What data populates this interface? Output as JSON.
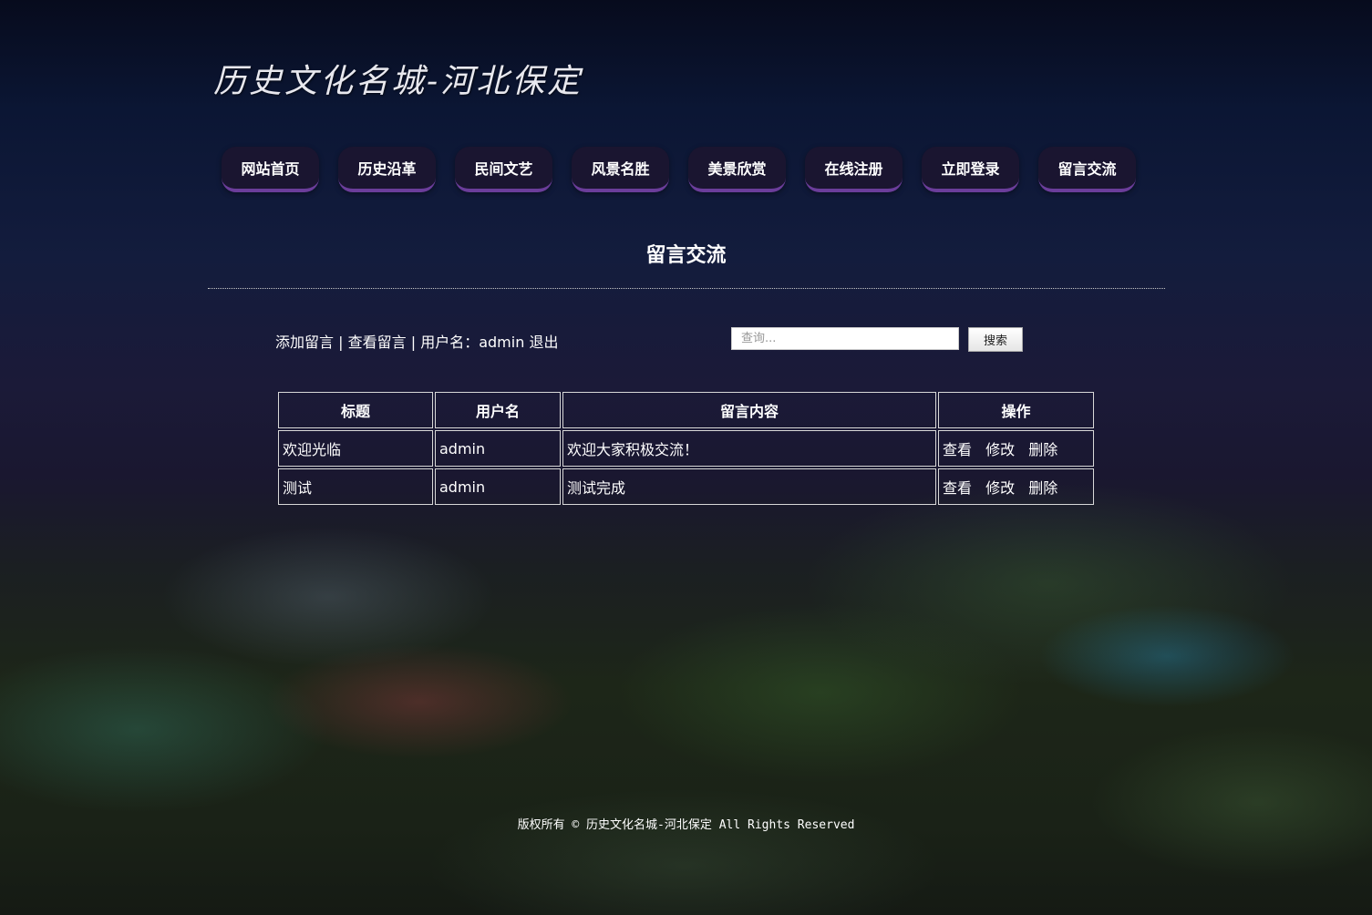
{
  "site": {
    "title": "历史文化名城-河北保定"
  },
  "nav": {
    "items": [
      "网站首页",
      "历史沿革",
      "民间文艺",
      "风景名胜",
      "美景欣赏",
      "在线注册",
      "立即登录",
      "留言交流"
    ]
  },
  "page": {
    "heading": "留言交流"
  },
  "toolbar": {
    "add_message": "添加留言",
    "separator": "|",
    "view_messages": "查看留言",
    "username_label": "用户名：",
    "username": "admin",
    "logout": "退出"
  },
  "search": {
    "placeholder": "查询...",
    "button_label": "搜索"
  },
  "table": {
    "headers": [
      "标题",
      "用户名",
      "留言内容",
      "操作"
    ],
    "actions": [
      "查看",
      "修改",
      "删除"
    ],
    "rows": [
      {
        "title": "欢迎光临",
        "user": "admin",
        "content": "欢迎大家积极交流！"
      },
      {
        "title": "测试",
        "user": "admin",
        "content": "测试完成"
      }
    ]
  },
  "footer": {
    "text": "版权所有 © 历史文化名城-河北保定 All Rights Reserved"
  }
}
